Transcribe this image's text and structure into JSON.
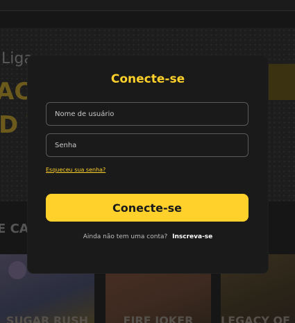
{
  "background": {
    "banner_text_1": "Liga",
    "banner_text_2": "AC",
    "banner_text_3": "D V",
    "section_heading": "E CA",
    "games": [
      {
        "title": "SUGAR RUSH"
      },
      {
        "title": "FIRE JOKER"
      },
      {
        "title": "LEGACY OF E"
      }
    ]
  },
  "login_modal": {
    "title": "Conecte-se",
    "username_placeholder": "Nome de usuário",
    "password_placeholder": "Senha",
    "forgot_password": "Esqueceu sua senha?",
    "submit_label": "Conecte-se",
    "signup_prompt": "Ainda não tem uma conta?",
    "signup_link": "Inscreva-se"
  },
  "colors": {
    "accent": "#ffd12a",
    "modal_background": "#1a1a1a",
    "page_background": "#161616"
  }
}
